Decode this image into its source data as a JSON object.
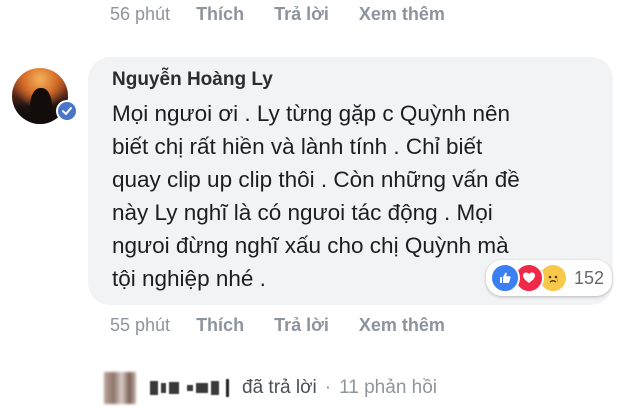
{
  "top_actions": {
    "time": "56 phút",
    "like": "Thích",
    "reply": "Trả lời",
    "more": "Xem thêm"
  },
  "comment": {
    "author": "Nguyễn Hoàng Ly",
    "text": "Mọi ngưoi ơi . Ly từng gặp c Quỳnh nên biết chị rất hiền và lành tính . Chỉ biết quay clip up clip thôi . Còn những vấn đề này Ly nghĩ là có ngưoi tác động . Mọi ngưoi đừng nghĩ xấu cho chị Quỳnh mà tội nghiệp nhé .",
    "reactions": {
      "icons": [
        "like-icon",
        "love-icon",
        "sad-icon"
      ],
      "count": "152"
    }
  },
  "bottom_actions": {
    "time": "55 phút",
    "like": "Thích",
    "reply": "Trả lời",
    "more": "Xem thêm"
  },
  "reply_summary": {
    "replied_text": "đã trả lời",
    "separator": "·",
    "replies_count": "11 phản hồi"
  },
  "colors": {
    "bubble": "#f2f3f5",
    "muted": "#90949c",
    "like": "#3b7ff2",
    "love": "#f0284a",
    "sad": "#f7c84a",
    "verified": "#4a76c8"
  }
}
